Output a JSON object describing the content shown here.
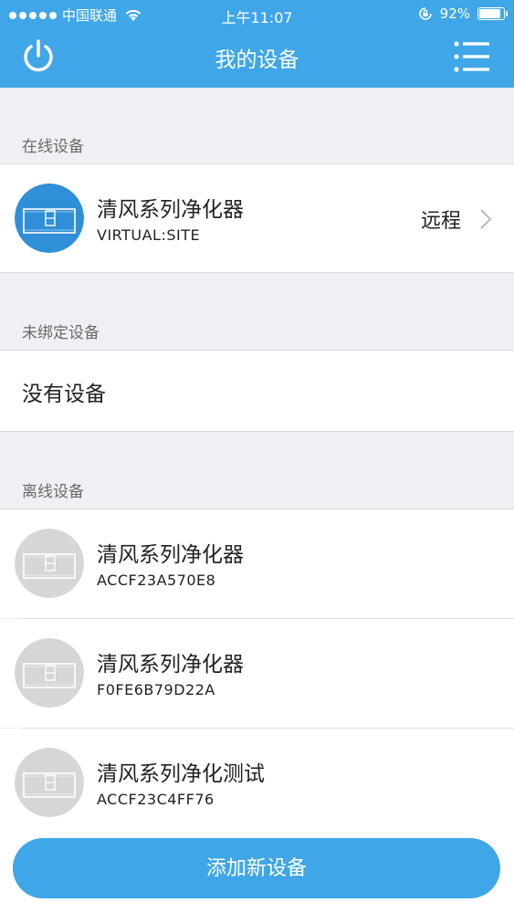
{
  "status_bar": {
    "carrier": "中国联通",
    "time": "上午11:07",
    "battery": "92%",
    "battery_level": 0.92,
    "wifi_icon": "wifi-icon",
    "lock_icon": "rotation-lock-icon"
  },
  "nav": {
    "title": "我的设备",
    "left_icon": "power-icon",
    "right_icon": "menu-list-icon"
  },
  "sections": {
    "online": {
      "label": "在线设备",
      "device": {
        "name": "清风系列净化器",
        "id": "VIRTUAL:SITE",
        "mode": "远程"
      }
    },
    "unbound": {
      "label": "未绑定设备",
      "empty": "没有设备"
    },
    "offline": {
      "label": "离线设备",
      "devices": [
        {
          "name": "清风系列净化器",
          "id": "ACCF23A570E8"
        },
        {
          "name": "清风系列净化器",
          "id": "F0FE6B79D22A"
        },
        {
          "name": "清风系列净化测试",
          "id": "ACCF23C4FF76"
        }
      ]
    }
  },
  "add_button": {
    "label": "添加新设备"
  },
  "colors": {
    "primary": "#3fa6e8",
    "online_icon": "#2f8fd8",
    "offline_icon": "#d6d6d9",
    "background": "#efeff4"
  }
}
